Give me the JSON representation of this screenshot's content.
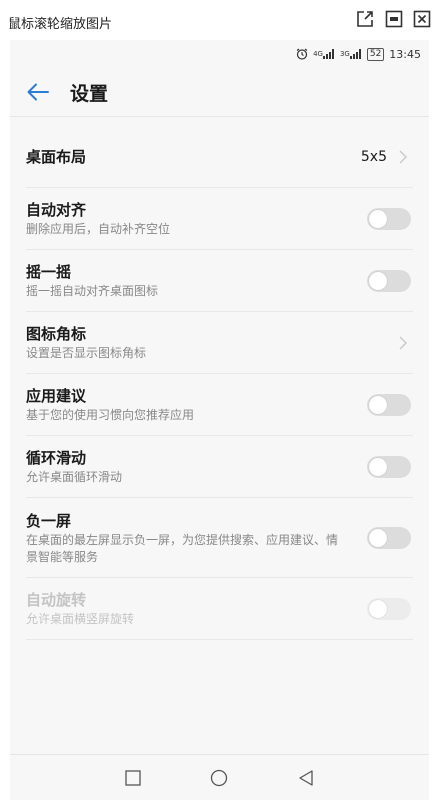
{
  "viewer": {
    "title": "鼠标滚轮缩放图片",
    "buttons": [
      "external-link-icon",
      "minimize-icon",
      "close-icon"
    ]
  },
  "status_bar": {
    "alarm_icon": "alarm-icon",
    "signal1_label": "4G",
    "signal2_label": "3G",
    "battery": "52",
    "time": "13:45"
  },
  "header": {
    "back_icon": "arrow-left-icon",
    "title": "设置"
  },
  "settings": {
    "desktop_layout": {
      "title": "桌面布局",
      "value": "5x5"
    },
    "auto_align": {
      "title": "自动对齐",
      "subtitle": "删除应用后，自动补齐空位",
      "enabled": false
    },
    "shake": {
      "title": "摇一摇",
      "subtitle": "摇一摇自动对齐桌面图标",
      "enabled": false
    },
    "icon_badge": {
      "title": "图标角标",
      "subtitle": "设置是否显示图标角标"
    },
    "app_suggest": {
      "title": "应用建议",
      "subtitle": "基于您的使用习惯向您推荐应用",
      "enabled": false
    },
    "loop_scroll": {
      "title": "循环滑动",
      "subtitle": "允许桌面循环滑动",
      "enabled": false
    },
    "minus_one": {
      "title": "负一屏",
      "subtitle": "在桌面的最左屏显示负一屏，为您提供搜索、应用建议、情景智能等服务",
      "enabled": false
    },
    "auto_rotate": {
      "title": "自动旋转",
      "subtitle": "允许桌面横竖屏旋转",
      "enabled": false,
      "disabled": true
    }
  },
  "nav": [
    "recent-apps-icon",
    "home-icon",
    "back-icon"
  ],
  "colors": {
    "accent": "#2b7cd3",
    "toggle_off": "#dcdcdc"
  }
}
